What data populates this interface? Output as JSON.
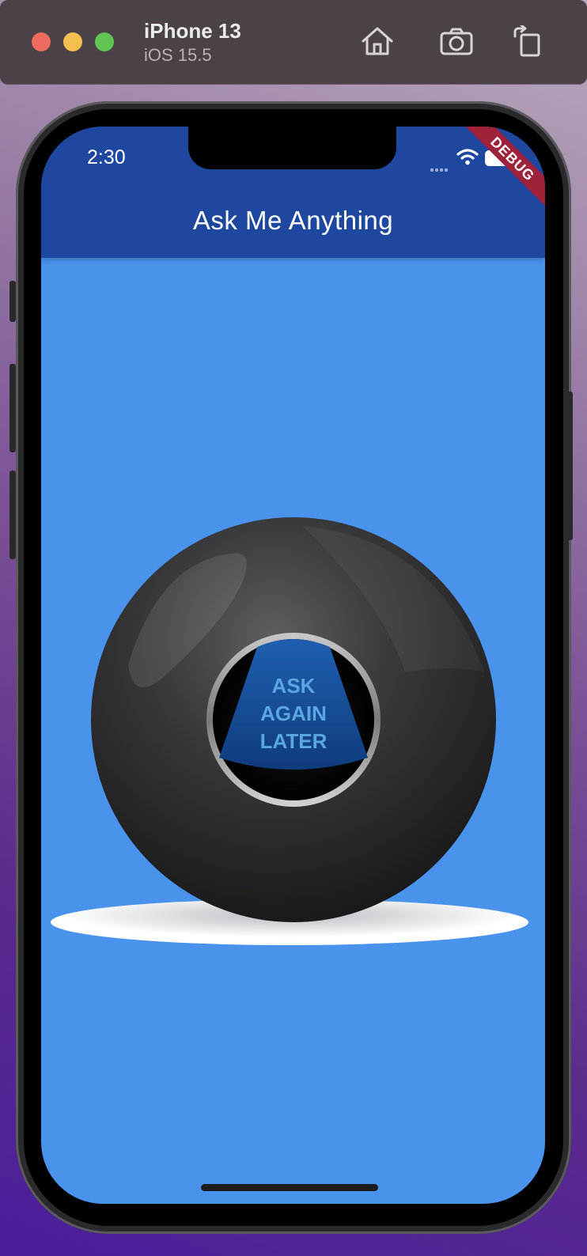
{
  "simulator": {
    "device_name": "iPhone 13",
    "os_version": "iOS 15.5",
    "toolbar_icons": [
      "home-icon",
      "screenshot-icon",
      "rotate-icon"
    ]
  },
  "status_bar": {
    "time": "2:30",
    "icons": [
      "signal-icon",
      "wifi-icon",
      "battery-icon"
    ]
  },
  "app_bar": {
    "title": "Ask Me Anything",
    "background_color": "#1e48a0"
  },
  "debug_banner": {
    "label": "DEBUG"
  },
  "body": {
    "background_color": "#4993ec",
    "ball_answer": {
      "lines": [
        "ASK",
        "AGAIN",
        "LATER"
      ]
    }
  }
}
